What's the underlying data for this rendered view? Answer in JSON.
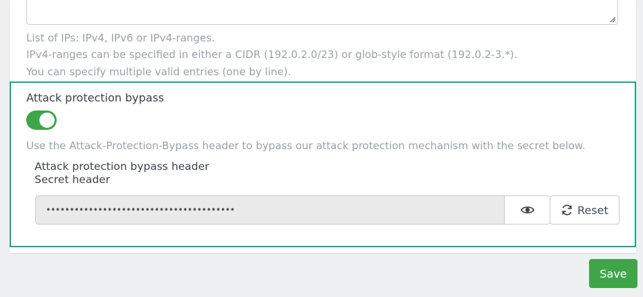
{
  "ip_help": {
    "line1": "List of IPs: IPv4, IPv6 or IPv4-ranges.",
    "line2": "IPv4-ranges can be specified in either a CIDR (192.0.2.0/23) or glob-style format (192.0.2-3.*).",
    "line3": "You can specify multiple valid entries (one by line)."
  },
  "bypass": {
    "title": "Attack protection bypass",
    "toggle_on": true,
    "help": "Use the Attack-Protection-Bypass header to bypass our attack protection mechanism with the secret below.",
    "header_label": "Attack protection bypass header",
    "secret_label": "Secret header",
    "secret_value": "••••••••••••••••••••••••••••••••••••••••",
    "reset_label": "Reset"
  },
  "footer": {
    "save_label": "Save"
  },
  "colors": {
    "accent_green": "#3fa548",
    "highlight_border": "#1aa58a"
  },
  "icons": {
    "show_secret": "eye-icon",
    "reset": "refresh-icon",
    "resize": "resize-handle-icon"
  }
}
